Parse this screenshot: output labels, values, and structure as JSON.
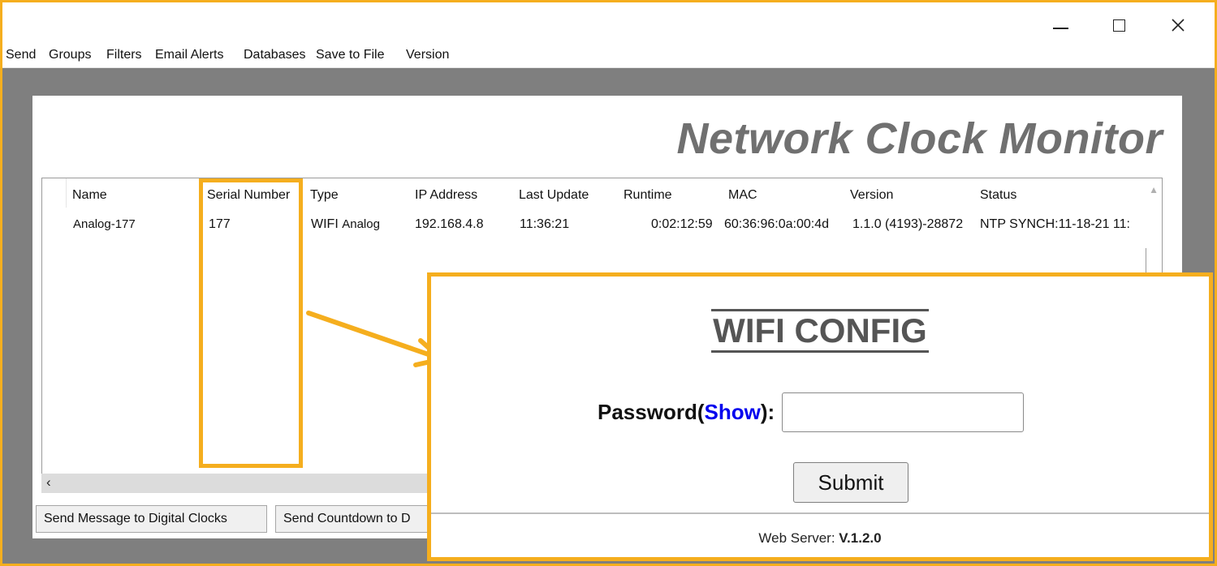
{
  "window": {
    "controls": {
      "minimize_icon": "minimize-icon",
      "maximize_icon": "maximize-icon",
      "close_icon": "close-icon"
    }
  },
  "menu": [
    "Send",
    "Groups",
    "Filters",
    "Email Alerts",
    "Databases",
    "Save to File",
    "Version"
  ],
  "app_title": "Network Clock Monitor",
  "table": {
    "headers": [
      "Name",
      "Serial Number",
      "Type",
      "IP Address",
      "Last Update",
      "Runtime",
      "MAC",
      "Version",
      "Status"
    ],
    "row": {
      "name": "Analog-177",
      "serial": "177",
      "type_main": "WIFI",
      "type_sub": "Analog",
      "ip": "192.168.4.8",
      "last_update": "11:36:21",
      "runtime": "0:02:12:59",
      "mac": "60:36:96:0a:00:4d",
      "version": "1.1.0 (4193)-28872",
      "status": "NTP SYNCH:11-18-21 11:"
    }
  },
  "buttons": {
    "send_message": "Send Message to Digital Clocks",
    "send_countdown": "Send Countdown to D"
  },
  "wifi_config": {
    "title": "WIFI CONFIG",
    "password_label": "Password(",
    "show_link": "Show",
    "password_label_end": "):",
    "password_value": "",
    "submit": "Submit",
    "footer_label": "Web Server: ",
    "footer_version": "V.1.2.0"
  },
  "colors": {
    "highlight": "#F5AE1E",
    "link": "#0000ee",
    "title_gray": "#707070"
  }
}
